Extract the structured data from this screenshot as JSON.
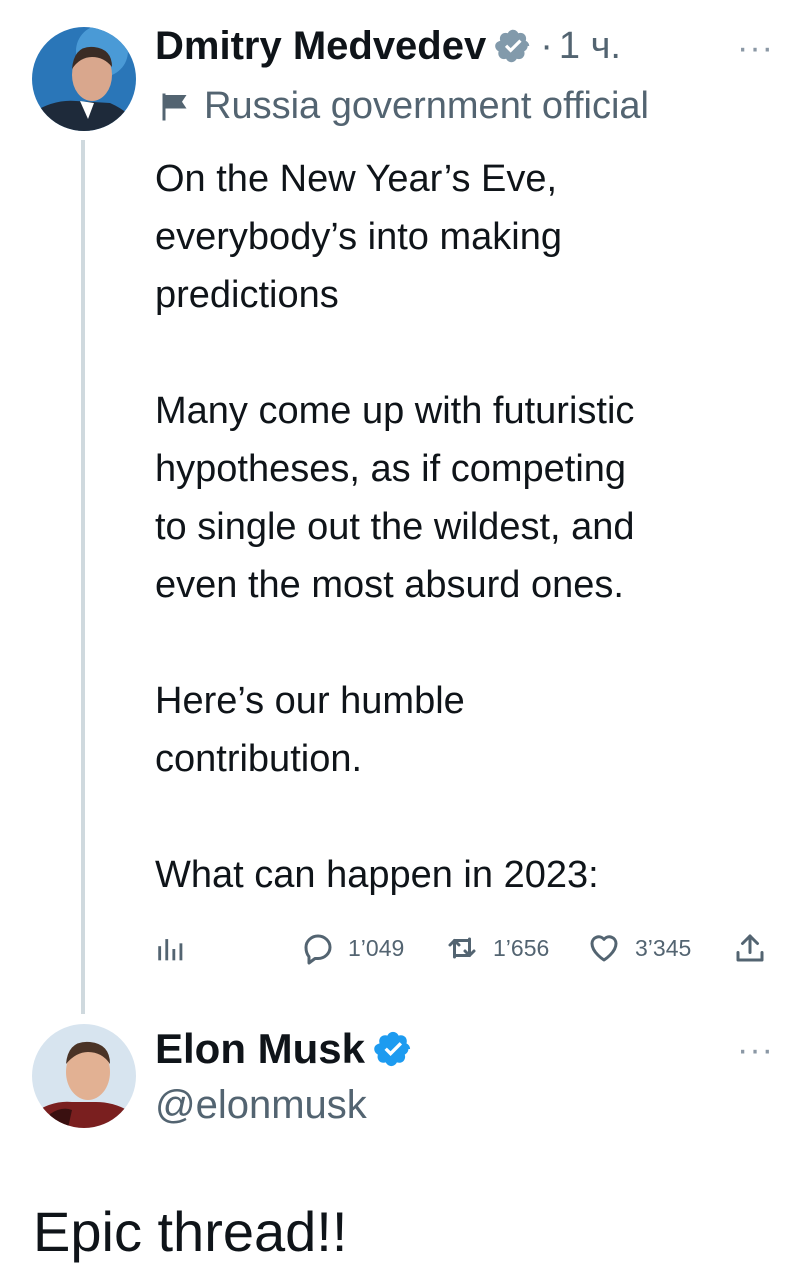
{
  "tweet1": {
    "author_name": "Dmitry Medvedev",
    "separator": "·",
    "time": "1 ч.",
    "label": "Russia government official",
    "paragraphs": [
      [
        "On the New Year’s Eve,",
        "everybody’s into making",
        "predictions"
      ],
      [
        "Many come up with futuristic",
        "hypotheses, as if competing",
        "to single out the wildest, and",
        "even the most absurd ones."
      ],
      [
        "Here’s our humble",
        "contribution."
      ],
      [
        "What can happen in 2023:"
      ]
    ],
    "metrics": {
      "replies": "1’049",
      "retweets": "1’656",
      "likes": "3’345"
    },
    "more": "···"
  },
  "tweet2": {
    "author_name": "Elon Musk",
    "handle": "@elonmusk",
    "more": "···",
    "text": "Epic thread!!"
  },
  "colors": {
    "verified_blue": "#1d9bf0",
    "verified_gray": "#829aab",
    "secondary": "#536471",
    "thread_line": "#cfd9de"
  },
  "icons": [
    "verified-gray-badge",
    "flag-icon",
    "more-icon",
    "analytics-icon",
    "reply-icon",
    "retweet-icon",
    "like-icon",
    "share-icon",
    "verified-blue-badge"
  ]
}
